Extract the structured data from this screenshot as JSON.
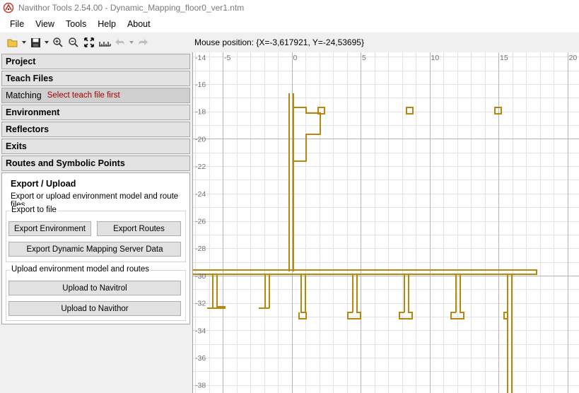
{
  "window": {
    "title": "Navithor Tools 2.54.00 - Dynamic_Mapping_floor0_ver1.ntm"
  },
  "menu": [
    "File",
    "View",
    "Tools",
    "Help",
    "About"
  ],
  "toolbar": {
    "icons": [
      "open-folder-icon",
      "save-icon",
      "zoom-in-icon",
      "zoom-out-icon",
      "fit-to-screen-icon",
      "measure-icon",
      "undo-icon",
      "redo-icon"
    ]
  },
  "sections": {
    "project": "Project",
    "teach_files": "Teach Files",
    "matching": "Matching",
    "matching_hint": "Select teach file first",
    "environment": "Environment",
    "reflectors": "Reflectors",
    "exits": "Exits",
    "routes": "Routes and Symbolic Points"
  },
  "export_panel": {
    "title": "Export / Upload",
    "description": "Export or upload environment model and route files",
    "export_group": "Export to file",
    "export_environment": "Export Environment",
    "export_routes": "Export Routes",
    "export_dms": "Export Dynamic Mapping Server Data",
    "upload_group": "Upload environment model and routes",
    "upload_navitrol": "Upload to Navitrol",
    "upload_navithor": "Upload to Navithor"
  },
  "status": {
    "mouse_position": "Mouse position: {X=-3,617921, Y=-24,53695}"
  },
  "map": {
    "x_ticks": [
      "-14",
      "-5",
      "0",
      "5",
      "10",
      "15",
      "20"
    ],
    "y_ticks": [
      "-16",
      "-18",
      "-20",
      "-22",
      "-24",
      "-26",
      "-28",
      "-30",
      "-32",
      "-34",
      "-36",
      "-38"
    ],
    "line_color": "#b8860b",
    "grid_color": "#e2e2e2",
    "major_grid_color": "#b5b5b5"
  }
}
